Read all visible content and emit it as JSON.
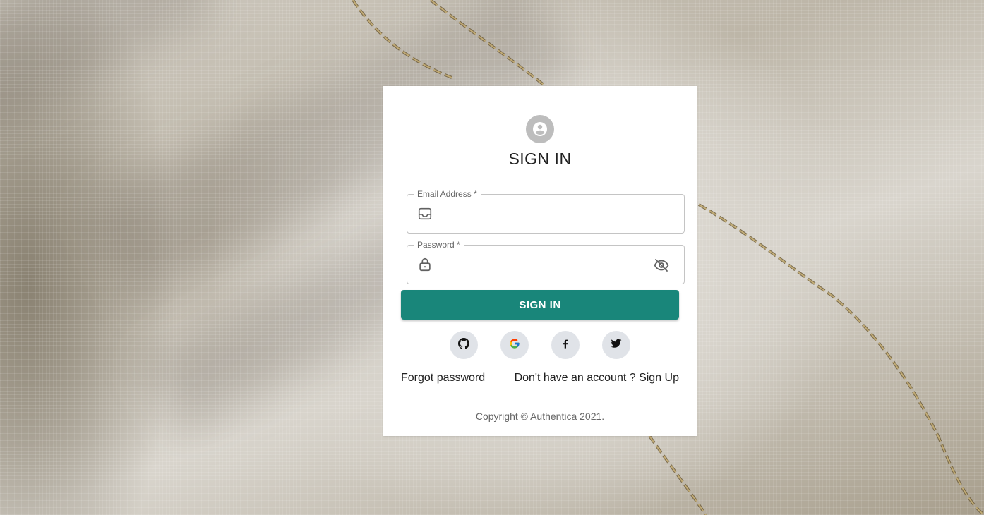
{
  "page": {
    "background_image": "sheer linen fabric with gold chain"
  },
  "login": {
    "title": "SIGN IN",
    "email": {
      "label": "Email Address *",
      "value": "",
      "icon": "inbox-icon"
    },
    "password": {
      "label": "Password *",
      "value": "",
      "icon": "lock-icon",
      "toggle_icon": "eye-off-icon"
    },
    "submit_label": "SIGN IN",
    "submit_color": "#19867a",
    "socials": [
      {
        "name": "github",
        "icon": "github-icon"
      },
      {
        "name": "google",
        "icon": "google-icon"
      },
      {
        "name": "facebook",
        "icon": "facebook-icon"
      },
      {
        "name": "twitter",
        "icon": "twitter-icon"
      }
    ],
    "forgot_password": "Forgot password",
    "signup_link": "Don't have an account ? Sign Up",
    "copyright": "Copyright © Authentica 2021."
  }
}
